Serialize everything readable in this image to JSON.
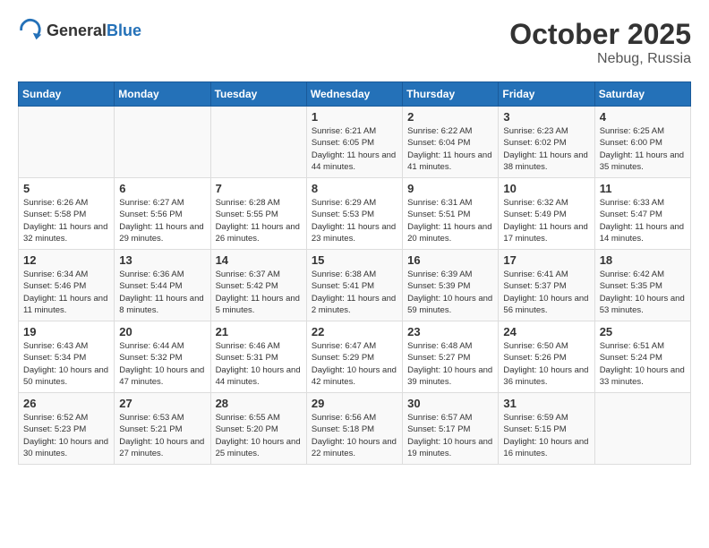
{
  "header": {
    "logo_general": "General",
    "logo_blue": "Blue",
    "month_year": "October 2025",
    "location": "Nebug, Russia"
  },
  "days_of_week": [
    "Sunday",
    "Monday",
    "Tuesday",
    "Wednesday",
    "Thursday",
    "Friday",
    "Saturday"
  ],
  "weeks": [
    [
      {
        "day": "",
        "info": ""
      },
      {
        "day": "",
        "info": ""
      },
      {
        "day": "",
        "info": ""
      },
      {
        "day": "1",
        "info": "Sunrise: 6:21 AM\nSunset: 6:05 PM\nDaylight: 11 hours\nand 44 minutes."
      },
      {
        "day": "2",
        "info": "Sunrise: 6:22 AM\nSunset: 6:04 PM\nDaylight: 11 hours\nand 41 minutes."
      },
      {
        "day": "3",
        "info": "Sunrise: 6:23 AM\nSunset: 6:02 PM\nDaylight: 11 hours\nand 38 minutes."
      },
      {
        "day": "4",
        "info": "Sunrise: 6:25 AM\nSunset: 6:00 PM\nDaylight: 11 hours\nand 35 minutes."
      }
    ],
    [
      {
        "day": "5",
        "info": "Sunrise: 6:26 AM\nSunset: 5:58 PM\nDaylight: 11 hours\nand 32 minutes."
      },
      {
        "day": "6",
        "info": "Sunrise: 6:27 AM\nSunset: 5:56 PM\nDaylight: 11 hours\nand 29 minutes."
      },
      {
        "day": "7",
        "info": "Sunrise: 6:28 AM\nSunset: 5:55 PM\nDaylight: 11 hours\nand 26 minutes."
      },
      {
        "day": "8",
        "info": "Sunrise: 6:29 AM\nSunset: 5:53 PM\nDaylight: 11 hours\nand 23 minutes."
      },
      {
        "day": "9",
        "info": "Sunrise: 6:31 AM\nSunset: 5:51 PM\nDaylight: 11 hours\nand 20 minutes."
      },
      {
        "day": "10",
        "info": "Sunrise: 6:32 AM\nSunset: 5:49 PM\nDaylight: 11 hours\nand 17 minutes."
      },
      {
        "day": "11",
        "info": "Sunrise: 6:33 AM\nSunset: 5:47 PM\nDaylight: 11 hours\nand 14 minutes."
      }
    ],
    [
      {
        "day": "12",
        "info": "Sunrise: 6:34 AM\nSunset: 5:46 PM\nDaylight: 11 hours\nand 11 minutes."
      },
      {
        "day": "13",
        "info": "Sunrise: 6:36 AM\nSunset: 5:44 PM\nDaylight: 11 hours\nand 8 minutes."
      },
      {
        "day": "14",
        "info": "Sunrise: 6:37 AM\nSunset: 5:42 PM\nDaylight: 11 hours\nand 5 minutes."
      },
      {
        "day": "15",
        "info": "Sunrise: 6:38 AM\nSunset: 5:41 PM\nDaylight: 11 hours\nand 2 minutes."
      },
      {
        "day": "16",
        "info": "Sunrise: 6:39 AM\nSunset: 5:39 PM\nDaylight: 10 hours\nand 59 minutes."
      },
      {
        "day": "17",
        "info": "Sunrise: 6:41 AM\nSunset: 5:37 PM\nDaylight: 10 hours\nand 56 minutes."
      },
      {
        "day": "18",
        "info": "Sunrise: 6:42 AM\nSunset: 5:35 PM\nDaylight: 10 hours\nand 53 minutes."
      }
    ],
    [
      {
        "day": "19",
        "info": "Sunrise: 6:43 AM\nSunset: 5:34 PM\nDaylight: 10 hours\nand 50 minutes."
      },
      {
        "day": "20",
        "info": "Sunrise: 6:44 AM\nSunset: 5:32 PM\nDaylight: 10 hours\nand 47 minutes."
      },
      {
        "day": "21",
        "info": "Sunrise: 6:46 AM\nSunset: 5:31 PM\nDaylight: 10 hours\nand 44 minutes."
      },
      {
        "day": "22",
        "info": "Sunrise: 6:47 AM\nSunset: 5:29 PM\nDaylight: 10 hours\nand 42 minutes."
      },
      {
        "day": "23",
        "info": "Sunrise: 6:48 AM\nSunset: 5:27 PM\nDaylight: 10 hours\nand 39 minutes."
      },
      {
        "day": "24",
        "info": "Sunrise: 6:50 AM\nSunset: 5:26 PM\nDaylight: 10 hours\nand 36 minutes."
      },
      {
        "day": "25",
        "info": "Sunrise: 6:51 AM\nSunset: 5:24 PM\nDaylight: 10 hours\nand 33 minutes."
      }
    ],
    [
      {
        "day": "26",
        "info": "Sunrise: 6:52 AM\nSunset: 5:23 PM\nDaylight: 10 hours\nand 30 minutes."
      },
      {
        "day": "27",
        "info": "Sunrise: 6:53 AM\nSunset: 5:21 PM\nDaylight: 10 hours\nand 27 minutes."
      },
      {
        "day": "28",
        "info": "Sunrise: 6:55 AM\nSunset: 5:20 PM\nDaylight: 10 hours\nand 25 minutes."
      },
      {
        "day": "29",
        "info": "Sunrise: 6:56 AM\nSunset: 5:18 PM\nDaylight: 10 hours\nand 22 minutes."
      },
      {
        "day": "30",
        "info": "Sunrise: 6:57 AM\nSunset: 5:17 PM\nDaylight: 10 hours\nand 19 minutes."
      },
      {
        "day": "31",
        "info": "Sunrise: 6:59 AM\nSunset: 5:15 PM\nDaylight: 10 hours\nand 16 minutes."
      },
      {
        "day": "",
        "info": ""
      }
    ]
  ]
}
